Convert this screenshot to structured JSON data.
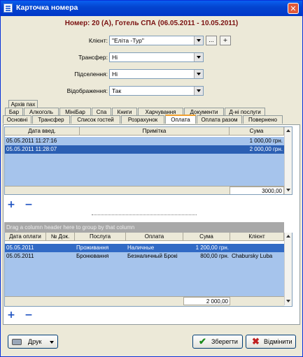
{
  "window": {
    "title": "Карточка номера"
  },
  "header": "Номер: 20 (А), Готель СПА (06.05.2011 - 10.05.2011)",
  "form": {
    "client_label": "Клієнт:",
    "client_value": "\"Еліта -Тур\"",
    "dots_label": "...",
    "plus_label": "+",
    "transfer_label": "Трансфер:",
    "transfer_value": "Ні",
    "settle_label": "Підселення:",
    "settle_value": "Ні",
    "display_label": "Відображення:",
    "display_value": "Так"
  },
  "tabs_row1": [
    "Архів пах"
  ],
  "tabs_row2": [
    "Бар",
    "Алкоголь",
    "МініБар",
    "Спа",
    "Книги",
    "Харчування",
    "Документи",
    "Д-ні послуги"
  ],
  "tabs_row3": [
    "Основні",
    "Трансфер",
    "Список гостей",
    "Розрахунок",
    "Оплата",
    "Оплата разом",
    "Повернено"
  ],
  "grid1": {
    "headers": [
      "Дата введ.",
      "Примітка",
      "Сума"
    ],
    "rows": [
      {
        "date": "05.05.2011 11:27:16",
        "note": "",
        "sum": "1 000,00 грн."
      },
      {
        "date": "05.05.2011 11:28:07",
        "note": "",
        "sum": "2 000,00 грн."
      }
    ],
    "total": "3000,00"
  },
  "group_hint": "Drag a column header here to group by that column",
  "grid2": {
    "headers": [
      "Дата оплати",
      "№ Док.",
      "Послуга",
      "Оплата",
      "Сума",
      "Клієнт"
    ],
    "rows": [
      {
        "date": "05.05.2011",
        "doc": "",
        "service": "Проживання",
        "payment": "Наличные",
        "sum": "1 200,00 грн.",
        "client": ""
      },
      {
        "date": "05.05.2011",
        "doc": "",
        "service": "Бронювання",
        "payment": "Безналичный Брокі",
        "sum": "800,00 грн.",
        "client": "Chabursky Luba"
      }
    ],
    "total": "2 000,00"
  },
  "buttons": {
    "add": "+",
    "remove": "−",
    "print": "Друк",
    "save": "Зберегти",
    "cancel": "Відмінити"
  },
  "colors": {
    "accent": "#316ac5",
    "header_text": "#7a1010",
    "title_bar": "#0445d0"
  }
}
